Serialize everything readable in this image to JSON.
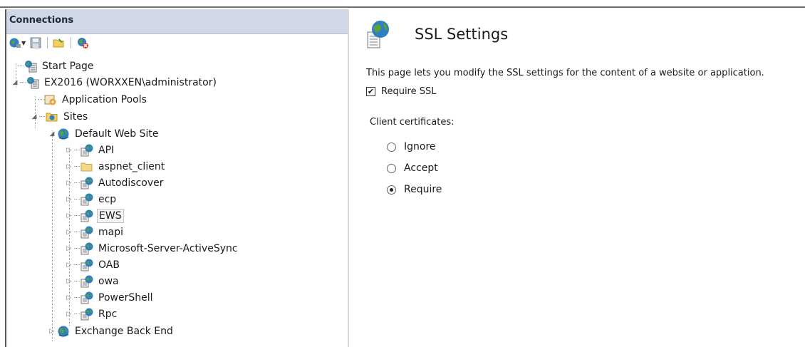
{
  "connections": {
    "header": "Connections",
    "toolbar": {
      "icons": [
        "connect-icon",
        "save-icon",
        "open-folder-icon",
        "disconnect-icon"
      ]
    },
    "tree": {
      "start_page": "Start Page",
      "server": "EX2016 (WORXXEN\\administrator)",
      "app_pools": "Application Pools",
      "sites": "Sites",
      "default_web_site": "Default Web Site",
      "children": [
        "API",
        "aspnet_client",
        "Autodiscover",
        "ecp",
        "EWS",
        "mapi",
        "Microsoft-Server-ActiveSync",
        "OAB",
        "owa",
        "PowerShell",
        "Rpc"
      ],
      "selected": "EWS",
      "exchange_back_end": "Exchange Back End"
    }
  },
  "ssl_settings": {
    "title": "SSL Settings",
    "description": "This page lets you modify the SSL settings for the content of a website or application.",
    "require_ssl_label": "Require SSL",
    "require_ssl_checked": true,
    "client_certificates_label": "Client certificates:",
    "options": [
      "Ignore",
      "Accept",
      "Require"
    ],
    "selected_option": "Require"
  },
  "colors": {
    "header_bg": "#cfd8e4",
    "globe_blue": "#2f7fc1",
    "globe_green": "#5aa33a"
  }
}
